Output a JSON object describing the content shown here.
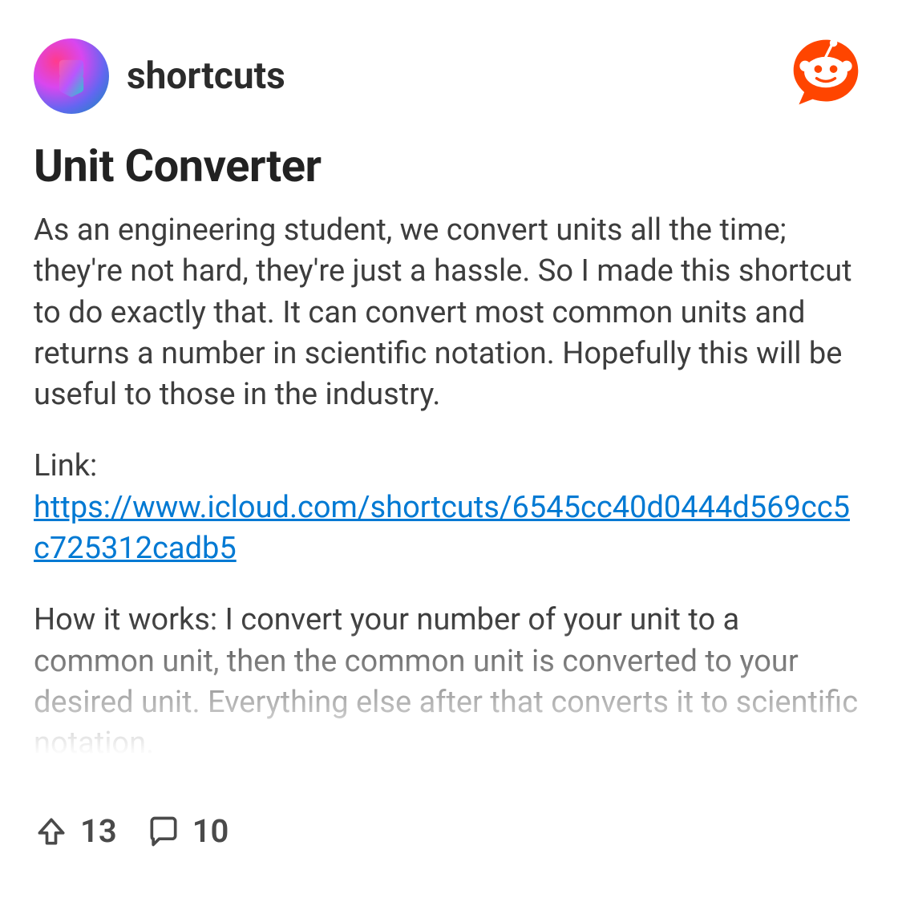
{
  "subreddit": {
    "name": "shortcuts"
  },
  "post": {
    "title": "Unit Converter",
    "paragraph1": "As an engineering student, we convert units all the time; they're not hard, they're just a hassle. So I made this shortcut to do exactly that. It can convert most common units and returns a number in scientific notation. Hopefully this will be useful to those in the industry.",
    "link_label": "Link:",
    "link_url": "https://www.icloud.com/shortcuts/6545cc40d0444d569cc5c725312cadb5",
    "paragraph3": "How it works: I convert your number of your unit to a common unit, then the common unit is converted to your desired unit. Everything else after that converts it to scientific notation."
  },
  "stats": {
    "upvotes": "13",
    "comments": "10"
  }
}
